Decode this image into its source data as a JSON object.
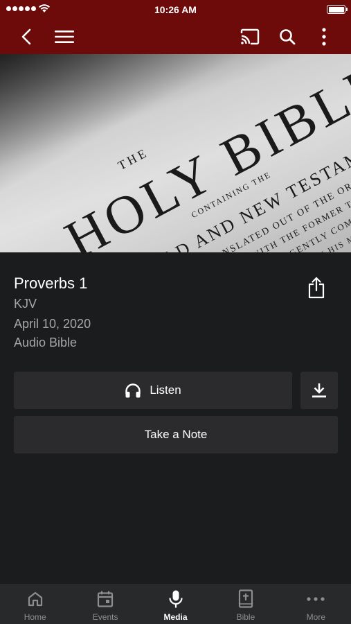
{
  "status_bar": {
    "time": "10:26 AM"
  },
  "nav": {
    "back_icon": "chevron-left-icon",
    "menu_icon": "hamburger-icon",
    "cast_icon": "cast-icon",
    "search_icon": "search-icon",
    "more_icon": "vertical-ellipsis-icon"
  },
  "hero": {
    "title_line1": "THE",
    "title_line2": "HOLY BIBLE",
    "line3": "CONTAINING THE",
    "line4": "OLD AND NEW TESTAMENTS",
    "line5": "TRANSLATED OUT OF THE ORIGINAL",
    "line6": "AND WITH THE FORMER TRANSLATIONS",
    "line7": "DILIGENTLY COMPARED",
    "line8": "BY HIS MAJESTY"
  },
  "media": {
    "title": "Proverbs 1",
    "version": "KJV",
    "date": "April 10, 2020",
    "category": "Audio Bible",
    "share_icon": "share-icon"
  },
  "actions": {
    "listen_label": "Listen",
    "listen_icon": "headphones-icon",
    "download_icon": "download-icon",
    "note_label": "Take a Note"
  },
  "tabs": [
    {
      "label": "Home",
      "icon": "home-icon",
      "active": false
    },
    {
      "label": "Events",
      "icon": "calendar-icon",
      "active": false
    },
    {
      "label": "Media",
      "icon": "microphone-icon",
      "active": true
    },
    {
      "label": "Bible",
      "icon": "bible-icon",
      "active": false
    },
    {
      "label": "More",
      "icon": "horizontal-ellipsis-icon",
      "active": false
    }
  ],
  "colors": {
    "header": "#6d0a0a",
    "background": "#1b1c1e",
    "button": "#2b2b2d",
    "tab_bar": "#28292b",
    "muted_text": "#a6a6a6"
  }
}
